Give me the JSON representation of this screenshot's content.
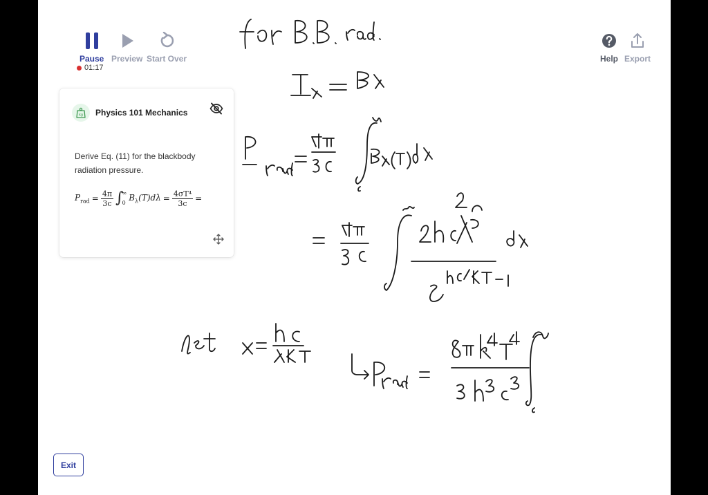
{
  "toolbar": {
    "pause_label": "Pause",
    "preview_label": "Preview",
    "start_over_label": "Start Over",
    "help_label": "Help",
    "export_label": "Export",
    "timer": "01:17"
  },
  "card": {
    "subject_icon_text": "kg",
    "title": "Physics 101 Mechanics",
    "question": "Derive Eq. (11) for the blackbody radiation pressure.",
    "equation": {
      "lhs": "P",
      "lhs_sub": "rad",
      "eq1": "=",
      "frac1_num": "4π",
      "frac1_den": "3c",
      "int_upper": "∞",
      "int_lower": "0",
      "integrand": "B",
      "integrand_sub": "λ",
      "integrand_rest": "(T)dλ",
      "eq2": "=",
      "frac2_num": "4σT⁴",
      "frac2_den": "3c",
      "eq3": "="
    }
  },
  "exit_label": "Exit",
  "colors": {
    "accent": "#2f3e9e",
    "disabled": "#9a9fb0",
    "record": "#d93030",
    "subject_bg": "#e6f6ea",
    "subject_fg": "#3f9a52"
  },
  "icons": [
    "pause-icon",
    "play-icon",
    "restart-icon",
    "help-icon",
    "export-icon",
    "scale-icon",
    "eye-off-icon",
    "move-icon"
  ]
}
